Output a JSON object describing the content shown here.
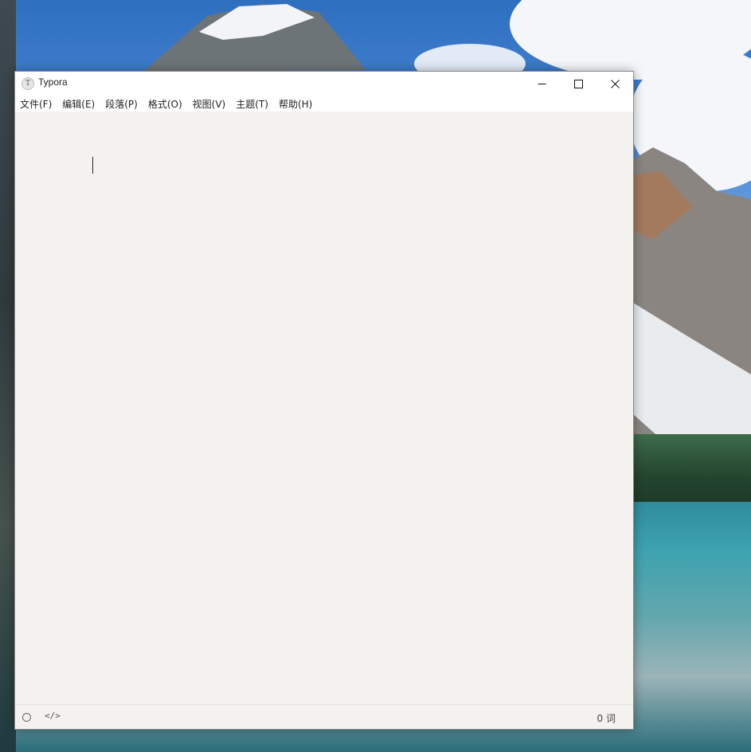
{
  "window": {
    "title": "Typora",
    "icon_letter": "T"
  },
  "controls": {
    "minimize_icon": "minimize-icon",
    "maximize_icon": "maximize-icon",
    "close_icon": "close-icon"
  },
  "menu": {
    "items": [
      {
        "label": "文件(F)"
      },
      {
        "label": "编辑(E)"
      },
      {
        "label": "段落(P)"
      },
      {
        "label": "格式(O)"
      },
      {
        "label": "视图(V)"
      },
      {
        "label": "主题(T)"
      },
      {
        "label": "帮助(H)"
      }
    ]
  },
  "editor": {
    "content": ""
  },
  "status": {
    "code_toggle": "</>",
    "word_count": "0 词"
  },
  "colors": {
    "editor_background": "#f3f2ee",
    "titlebar_background": "#ffffff"
  }
}
